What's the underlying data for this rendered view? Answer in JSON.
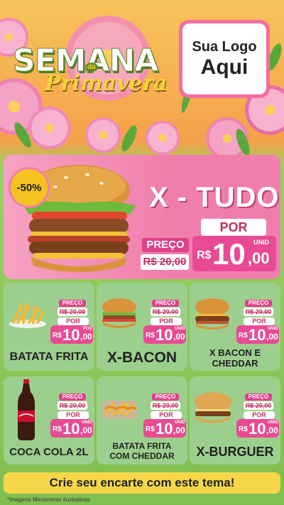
{
  "header": {
    "title_main": "SEMANA",
    "title_connector": "da",
    "title_sub": "Primavera",
    "logo_line1": "Sua Logo",
    "logo_line2": "Aqui"
  },
  "hero": {
    "badge": "-50%",
    "name": "X - TUDO",
    "preco_label": "PREÇO",
    "old_price": "R$ 20,00",
    "por_label": "POR",
    "unid_label": "UNID",
    "currency": "R$",
    "new_price_int": "10",
    "new_price_dec": ",00"
  },
  "products": [
    {
      "name": "BATATA FRITA",
      "preco_label": "PREÇO",
      "old_price": "R$ 20,00",
      "por_label": "POR",
      "unit": "POÇ",
      "currency": "R$",
      "price_int": "10",
      "price_dec": ",00"
    },
    {
      "name": "X-BACON",
      "preco_label": "PREÇO",
      "old_price": "R$ 20,00",
      "por_label": "POR",
      "unit": "UNID",
      "currency": "R$",
      "price_int": "10",
      "price_dec": ",00"
    },
    {
      "name": "X BACON E CHEDDAR",
      "preco_label": "PREÇO",
      "old_price": "R$ 20,00",
      "por_label": "POR",
      "unit": "UNID",
      "currency": "R$",
      "price_int": "10",
      "price_dec": ",00"
    },
    {
      "name": "COCA COLA 2L",
      "preco_label": "PREÇO",
      "old_price": "R$ 20,00",
      "por_label": "POR",
      "unit": "UNID",
      "currency": "R$",
      "price_int": "10",
      "price_dec": ",00"
    },
    {
      "name": "BATATA FRITA COM CHEDDAR",
      "preco_label": "PREÇO",
      "old_price": "R$ 20,00",
      "por_label": "POR",
      "unit": "UNID",
      "currency": "R$",
      "price_int": "10",
      "price_dec": ",00"
    },
    {
      "name": "X-BURGUER",
      "preco_label": "PREÇO",
      "old_price": "R$ 20,00",
      "por_label": "POR",
      "unit": "UNID",
      "currency": "R$",
      "price_int": "10",
      "price_dec": ",00"
    }
  ],
  "footer": {
    "cta": "Crie seu encarte com este tema!",
    "disclaimer": "*Imagens Meramente Ilustrativas"
  },
  "colors": {
    "pink_accent": "#e84b93",
    "card_green": "#9ccf8e",
    "footer_yellow": "#f7d74a"
  }
}
